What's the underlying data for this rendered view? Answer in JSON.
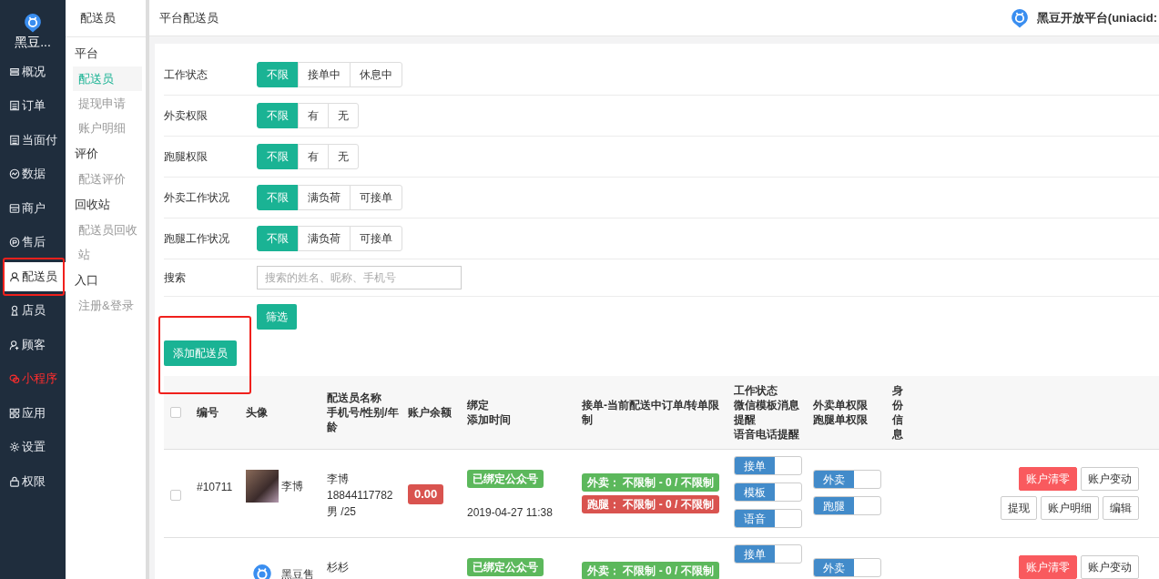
{
  "sidebar": {
    "brand": "黑豆...",
    "items": [
      {
        "label": "概况",
        "selected": false,
        "highlighted": false
      },
      {
        "label": "订单",
        "selected": false,
        "highlighted": false
      },
      {
        "label": "当面付",
        "selected": false,
        "highlighted": false
      },
      {
        "label": "数据",
        "selected": false,
        "highlighted": false
      },
      {
        "label": "商户",
        "selected": false,
        "highlighted": false
      },
      {
        "label": "售后",
        "selected": false,
        "highlighted": false
      },
      {
        "label": "配送员",
        "selected": true,
        "highlighted": false
      },
      {
        "label": "店员",
        "selected": false,
        "highlighted": false
      },
      {
        "label": "顾客",
        "selected": false,
        "highlighted": false
      },
      {
        "label": "小程序",
        "selected": false,
        "highlighted": true
      },
      {
        "label": "应用",
        "selected": false,
        "highlighted": false
      },
      {
        "label": "设置",
        "selected": false,
        "highlighted": false
      },
      {
        "label": "权限",
        "selected": false,
        "highlighted": false
      }
    ]
  },
  "subnav": {
    "title": "配送员",
    "groups": [
      {
        "label": "平台",
        "items": [
          {
            "label": "配送员",
            "selected": true
          },
          {
            "label": "提现申请",
            "selected": false
          },
          {
            "label": "账户明细",
            "selected": false
          }
        ]
      },
      {
        "label": "评价",
        "items": [
          {
            "label": "配送评价",
            "selected": false
          }
        ]
      },
      {
        "label": "回收站",
        "items": [
          {
            "label": "配送员回收站",
            "selected": false
          }
        ]
      },
      {
        "label": "入口",
        "items": [
          {
            "label": "注册&登录",
            "selected": false
          }
        ]
      }
    ]
  },
  "header": {
    "title": "平台配送员",
    "platform": "黑豆开放平台(uniacid:"
  },
  "filters": [
    {
      "label": "工作状态",
      "options": [
        {
          "label": "不限",
          "selected": true
        },
        {
          "label": "接单中",
          "selected": false
        },
        {
          "label": "休息中",
          "selected": false
        }
      ]
    },
    {
      "label": "外卖权限",
      "options": [
        {
          "label": "不限",
          "selected": true
        },
        {
          "label": "有",
          "selected": false
        },
        {
          "label": "无",
          "selected": false
        }
      ]
    },
    {
      "label": "跑腿权限",
      "options": [
        {
          "label": "不限",
          "selected": true
        },
        {
          "label": "有",
          "selected": false
        },
        {
          "label": "无",
          "selected": false
        }
      ]
    },
    {
      "label": "外卖工作状况",
      "options": [
        {
          "label": "不限",
          "selected": true
        },
        {
          "label": "满负荷",
          "selected": false
        },
        {
          "label": "可接单",
          "selected": false
        }
      ]
    },
    {
      "label": "跑腿工作状况",
      "options": [
        {
          "label": "不限",
          "selected": true
        },
        {
          "label": "满负荷",
          "selected": false
        },
        {
          "label": "可接单",
          "selected": false
        }
      ]
    }
  ],
  "search": {
    "label": "搜索",
    "placeholder": "搜索的姓名、昵称、手机号"
  },
  "filter_button": "筛选",
  "add_button": "添加配送员",
  "table": {
    "all_selected": false,
    "columns": [
      [
        "编号"
      ],
      [
        "头像"
      ],
      [
        "配送员名称",
        "手机号/性别/年龄"
      ],
      [
        "账户余额"
      ],
      [
        "绑定",
        "添加时间"
      ],
      [
        "接单-当前配送中订单/转单限制"
      ],
      [
        "工作状态",
        "微信模板消息提醒",
        "语音电话提醒"
      ],
      [
        "外卖单权限",
        "跑腿单权限"
      ],
      [
        "身份信息"
      ]
    ],
    "rows": [
      {
        "selected": false,
        "id": "#10711",
        "avatar": {
          "kind": "photo"
        },
        "nickname": "李博",
        "name": "李博",
        "phone": "18844117782",
        "gender_age": "男 /25",
        "balance": "0.00",
        "balance_positive": false,
        "bound": "已绑定公众号",
        "time": "2019-04-27 11:38",
        "limits": [
          {
            "text": "外卖： 不限制 - 0 / 不限制",
            "color": "#5cb85c"
          },
          {
            "text": "跑腿： 不限制 - 0 / 不限制",
            "color": "#d9534f"
          }
        ],
        "work_switches": [
          {
            "label": "接单",
            "on": false
          },
          {
            "label": "模板",
            "on": false
          },
          {
            "label": "语音",
            "on": false
          }
        ],
        "perm_switches": [
          {
            "label": "外卖",
            "on": false
          },
          {
            "label": "跑腿",
            "on": false
          }
        ],
        "actions": [
          [
            {
              "label": "账户清零",
              "kind": "danger"
            },
            {
              "label": "账户变动",
              "kind": "default"
            }
          ],
          [
            {
              "label": "提现",
              "kind": "default"
            },
            {
              "label": "账户明细",
              "kind": "default"
            },
            {
              "label": "编辑",
              "kind": "default"
            }
          ]
        ]
      },
      {
        "avatar": {
          "kind": "logo"
        },
        "nickname": "黑豆售",
        "name": "杉杉",
        "bound": "已绑定公众号",
        "limits": [
          {
            "text": "外卖： 不限制 - 0 / 不限制",
            "color": "#5cb85c"
          }
        ],
        "work_switches": [
          {
            "label": "接单",
            "on": false
          }
        ],
        "perm_switches": [
          {
            "label": "外卖",
            "on": false
          }
        ],
        "actions": [
          [
            {
              "label": "账户清零",
              "kind": "danger"
            },
            {
              "label": "账户变动",
              "kind": "default"
            }
          ]
        ]
      }
    ]
  }
}
